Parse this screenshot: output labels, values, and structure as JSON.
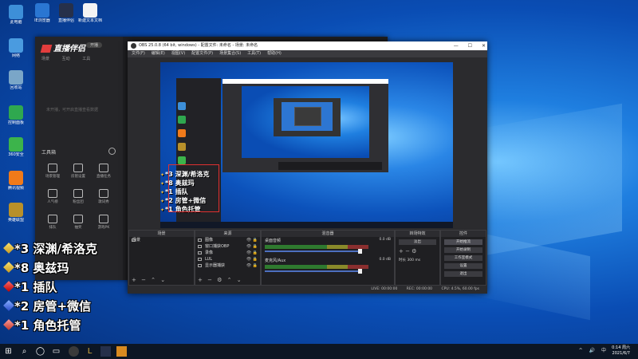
{
  "desktop": {
    "icons": [
      {
        "label": "此电脑",
        "color": "#3d8fd8"
      },
      {
        "label": "网络",
        "color": "#4a9be0"
      },
      {
        "label": "回收站",
        "color": "#7aa6c8"
      },
      {
        "label": "控制面板",
        "color": "#2fa84f"
      },
      {
        "label": "360安全",
        "color": "#3cb44b"
      },
      {
        "label": "腾讯视频",
        "color": "#f07a1a"
      },
      {
        "label": "英雄联盟",
        "color": "#b8902a"
      },
      {
        "label": "直播伴侣",
        "color": "#2ab0e0"
      },
      {
        "label": "游戏加速器",
        "color": "#4ecb71"
      }
    ],
    "top_icons": [
      {
        "label": "IE浏览器",
        "color": "#2a76d2"
      },
      {
        "label": "直播伴侣",
        "color": "#26304a"
      },
      {
        "label": "新建文本文档",
        "color": "#f4f4f4"
      }
    ]
  },
  "assistant": {
    "app_name": "直播伴侣",
    "badge": "开播",
    "tabs": [
      "场景",
      "互动",
      "工具"
    ],
    "hint": "未开播，可开启直播查看数据",
    "tools_label": "工具箱",
    "tools": [
      {
        "label": "场景管理",
        "icon": "scene-icon"
      },
      {
        "label": "房管设置",
        "icon": "admin-icon"
      },
      {
        "label": "直播任务",
        "icon": "task-icon"
      },
      {
        "label": "人气榜",
        "icon": "rank-icon"
      },
      {
        "label": "粉丝团",
        "icon": "fans-icon"
      },
      {
        "label": "歌词秀",
        "icon": "lyrics-icon"
      },
      {
        "label": "排队",
        "icon": "queue-icon"
      },
      {
        "label": "抽奖",
        "icon": "lottery-icon"
      },
      {
        "label": "游戏PK",
        "icon": "pk-icon"
      }
    ]
  },
  "obs": {
    "title": "OBS 25.0.8 (64 bit, windows) - 配置文件: 未命名 - 场景: 未命名",
    "menu": [
      "文件(F)",
      "编辑(E)",
      "视图(V)",
      "配置文件(P)",
      "场景集合(S)",
      "工具(T)",
      "帮助(H)"
    ],
    "docks": {
      "scenes": {
        "title": "场景",
        "items": [
          "场景"
        ]
      },
      "sources": {
        "title": "来源",
        "items": [
          "图像",
          "窗口捕获OBP",
          "录像",
          "LUL",
          "显示器捕获"
        ]
      },
      "mixer": {
        "title": "混音器",
        "channels": [
          {
            "name": "桌面音频",
            "db": "0.0 dB"
          },
          {
            "name": "麦克风/Aux",
            "db": "0.0 dB"
          }
        ]
      },
      "transitions": {
        "title": "转场特效",
        "type": "淡出",
        "duration_label": "时长",
        "duration": "300 ms"
      },
      "controls": {
        "title": "控件",
        "buttons": [
          "开始推流",
          "开始录制",
          "工作室模式",
          "设置",
          "退出"
        ]
      }
    },
    "status": {
      "live": "LIVE: 00:00:00",
      "rec": "REC: 00:00:00",
      "cpu": "CPU: 4.5%, 60.00 fps"
    }
  },
  "overlay": {
    "lines": [
      "*3 深渊/希洛克",
      "*8 奥兹玛",
      "*1 插队",
      "*2 房管+微信",
      "*1 角色托管"
    ]
  },
  "taskbar": {
    "search_icon": "search-icon",
    "tray": [
      "^",
      "🔊",
      "中"
    ],
    "time": "0:14 周六",
    "date": "2021/6/7"
  },
  "colors": {
    "obs_bg": "#2b2b2e",
    "accent_red": "#e03030",
    "desktop_blue": "#0a4db4"
  }
}
